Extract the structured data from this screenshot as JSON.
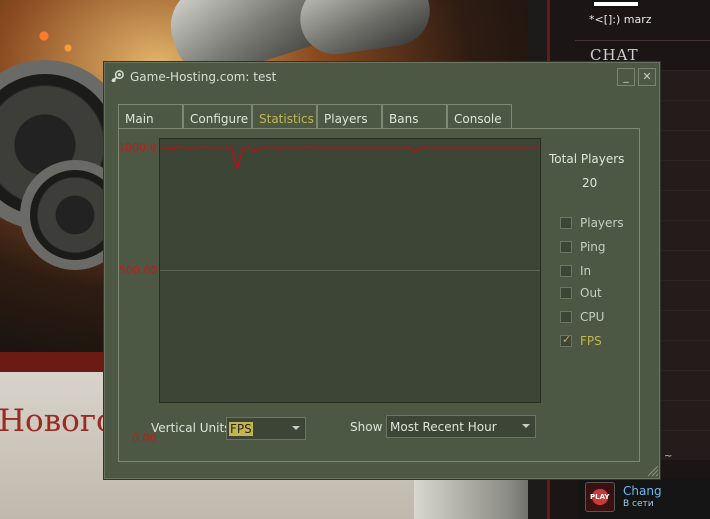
{
  "background": {
    "left_text": "Нового",
    "friend_panel": {
      "top_name": "*<[]:) marz",
      "chat_header": "CHAT",
      "friend_name": "Chang",
      "friend_status": "В сети",
      "tilde": "~",
      "avatar_badge": "PLAY"
    }
  },
  "window": {
    "title": "Game-Hosting.com: test",
    "minimize": "_",
    "close": "✕",
    "tabs": [
      {
        "label": "Main"
      },
      {
        "label": "Configure"
      },
      {
        "label": "Statistics"
      },
      {
        "label": "Players"
      },
      {
        "label": "Bans"
      },
      {
        "label": "Console"
      }
    ],
    "active_tab": "Statistics",
    "stats": {
      "y_labels": {
        "top": "1000.0",
        "mid": "500.00",
        "bottom": "0.00"
      },
      "total_players_label": "Total Players",
      "total_players_value": "20",
      "toggles": [
        {
          "label": "Players",
          "checked": false
        },
        {
          "label": "Ping",
          "checked": false
        },
        {
          "label": "In",
          "checked": false
        },
        {
          "label": "Out",
          "checked": false
        },
        {
          "label": "CPU",
          "checked": false
        },
        {
          "label": "FPS",
          "checked": true
        }
      ],
      "vertical_units_label": "Vertical Units",
      "vertical_units_value": "FPS",
      "show_label": "Show",
      "show_value": "Most Recent Hour"
    }
  },
  "chart_data": {
    "type": "line",
    "ylim": [
      0,
      1000
    ],
    "y_ticks": [
      "0.00",
      "500.00",
      "1000.0"
    ],
    "series": [
      {
        "values": [
          990,
          990,
          985,
          992,
          990,
          988,
          990,
          991,
          990,
          989,
          990,
          990,
          990,
          910,
          990,
          991,
          975,
          990,
          990,
          990,
          988,
          990,
          990,
          990,
          990,
          991,
          990,
          990,
          990,
          990,
          990,
          990,
          990,
          990,
          990,
          990,
          990,
          990,
          990,
          990,
          990,
          990,
          990,
          975,
          990,
          990,
          990,
          990,
          990,
          990,
          990,
          990,
          990,
          990,
          990,
          990,
          990,
          990,
          990,
          990,
          990,
          990,
          990,
          990,
          990
        ],
        "color": "#b0141a"
      }
    ],
    "grid": true
  }
}
